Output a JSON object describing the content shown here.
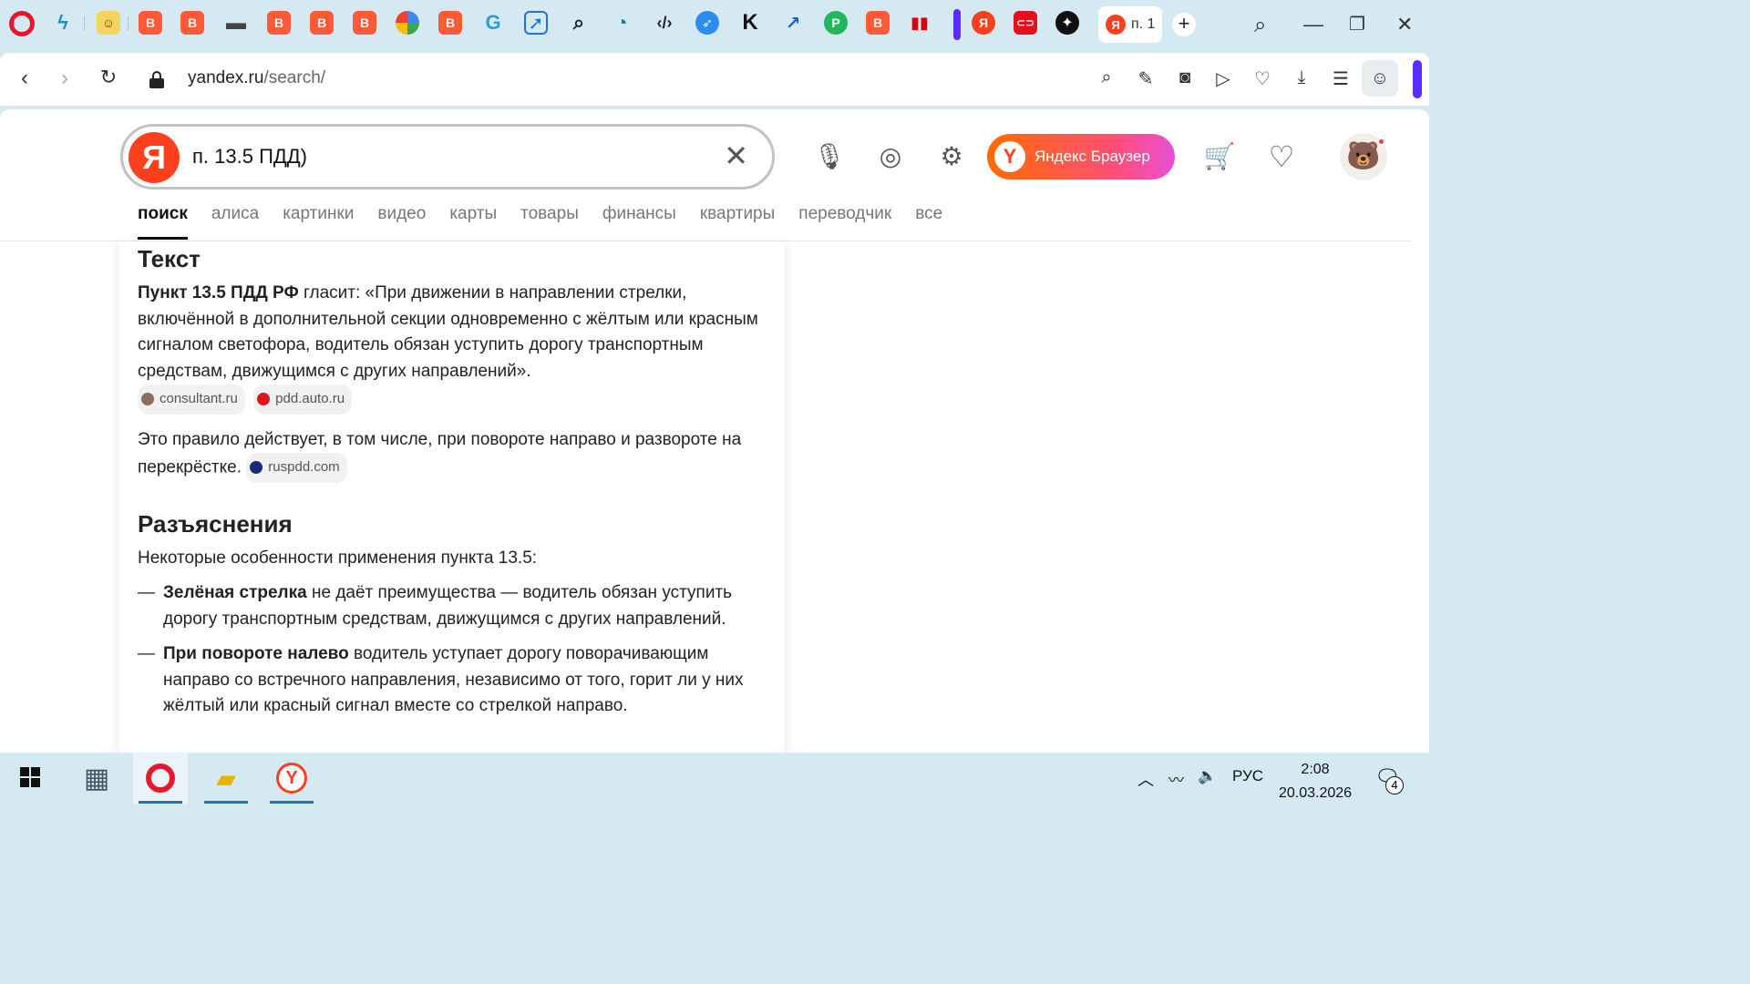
{
  "browser": {
    "active_tab": {
      "icon_letter": "Я",
      "label": "п. 1"
    },
    "address": {
      "host": "yandex.ru",
      "path": "/search/"
    },
    "window_controls": {
      "search": "⌕",
      "minimize": "—",
      "restore": "❐",
      "close": "✕"
    }
  },
  "search": {
    "logo_letter": "Я",
    "query": "п. 13.5 ПДД)",
    "browser_promo": "Яндекс Браузер",
    "nav_tabs": [
      "поиск",
      "алиса",
      "картинки",
      "видео",
      "карты",
      "товары",
      "финансы",
      "квартиры",
      "переводчик",
      "все"
    ]
  },
  "answer": {
    "section1_title": "Текст",
    "p1_bold": "Пункт 13.5 ПДД РФ",
    "p1_text": " гласит: «При движении в направлении стрелки, включённой в дополнительной секции одновременно с жёлтым или красным сигналом светофора, водитель обязан уступить дорогу транспортным средствам, движущимся с других направлений».",
    "source1": "consultant.ru",
    "source2": "pdd.auto.ru",
    "p2_text": "Это правило действует, в том числе, при повороте направо и развороте на перекрёстке.",
    "source3": "ruspdd.com",
    "section2_title": "Разъяснения",
    "p3_text": "Некоторые особенности применения пункта 13.5:",
    "dash": "—",
    "item1_bold": "Зелёная стрелка",
    "item1_text": " не даёт преимущества — водитель обязан уступить дорогу транспортным средствам, движущимся с других направлений.",
    "item2_bold": "При повороте налево",
    "item2_text": " водитель уступает дорогу поворачивающим направо со встречного направления, независимо от того, горит ли у них жёлтый или красный сигнал вместе со стрелкой направо."
  },
  "taskbar": {
    "language": "РУС",
    "time": "2:08",
    "date": "20.03.2026",
    "notification_count": "4"
  },
  "colors": {
    "yandex_red": "#fc3f1d",
    "opera_red": "#e5182c",
    "taskbar_bg": "#d4e9f2"
  }
}
